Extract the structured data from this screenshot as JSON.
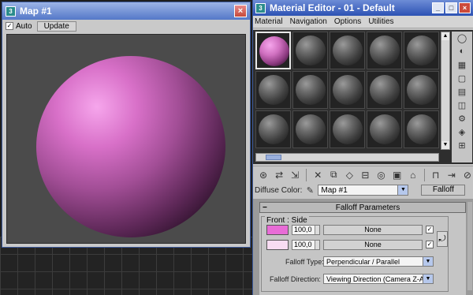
{
  "map_window": {
    "title": "Map #1",
    "close_label": "×",
    "auto_label": "Auto",
    "auto_checked": true,
    "update_label": "Update",
    "sphere_color": "#d870c8"
  },
  "material_editor": {
    "title": "Material Editor - 01 - Default",
    "window_buttons": [
      "_",
      "□",
      "×"
    ],
    "menu": [
      "Material",
      "Navigation",
      "Options",
      "Utilities"
    ],
    "slots_count": 15,
    "active_slot": 0,
    "diffuse": {
      "label": "Diffuse Color:",
      "map_name": "Map #1",
      "type_button": "Falloff"
    },
    "falloff": {
      "rollout_title": "Falloff Parameters",
      "group_label": "Front : Side",
      "rows": [
        {
          "color": "#e86cd6",
          "amount": "100,0",
          "map": "None",
          "checked": true
        },
        {
          "color": "#f8dcf2",
          "amount": "100,0",
          "map": "None",
          "checked": true
        }
      ],
      "falloff_type_label": "Falloff Type:",
      "falloff_type_value": "Perpendicular / Parallel",
      "falloff_direction_label": "Falloff Direction:",
      "falloff_direction_value": "Viewing Direction (Camera Z-Axis)"
    }
  }
}
